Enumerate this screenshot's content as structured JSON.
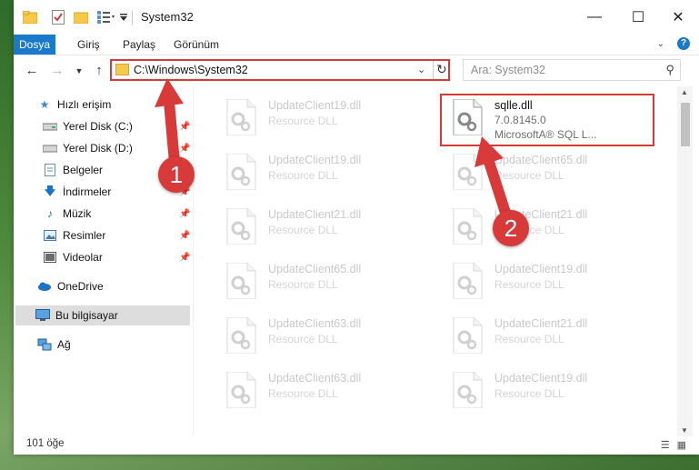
{
  "window": {
    "title": "System32"
  },
  "ribbon": {
    "tabs": [
      "Dosya",
      "Giriş",
      "Paylaş",
      "Görünüm"
    ]
  },
  "window_buttons": {
    "minimize": "—",
    "maximize": "☐",
    "close": "✕"
  },
  "navigation": {
    "address": "C:\\Windows\\System32",
    "search_placeholder": "Ara: System32"
  },
  "sidebar": {
    "items": [
      {
        "label": "Hızlı erişim",
        "icon": "star-icon",
        "pinned": false
      },
      {
        "label": "Yerel Disk (C:)",
        "icon": "drive-icon",
        "pinned": true
      },
      {
        "label": "Yerel Disk (D:)",
        "icon": "drive-icon",
        "pinned": true
      },
      {
        "label": "Belgeler",
        "icon": "documents-icon",
        "pinned": true
      },
      {
        "label": "İndirmeler",
        "icon": "downloads-icon",
        "pinned": true
      },
      {
        "label": "Müzik",
        "icon": "music-icon",
        "pinned": true
      },
      {
        "label": "Resimler",
        "icon": "pictures-icon",
        "pinned": true
      },
      {
        "label": "Videolar",
        "icon": "videos-icon",
        "pinned": true
      },
      {
        "label": "OneDrive",
        "icon": "cloud-icon",
        "pinned": false
      },
      {
        "label": "Bu bilgisayar",
        "icon": "computer-icon",
        "pinned": false
      },
      {
        "label": "Ağ",
        "icon": "network-icon",
        "pinned": false
      }
    ]
  },
  "files": {
    "active": {
      "name": "sqlle.dll",
      "version": "7.0.8145.0",
      "company": "MicrosoftA® SQL L..."
    },
    "left_column": [
      {
        "name": "UpdateClient19.dll",
        "desc": "Resource DLL"
      },
      {
        "name": "UpdateClient19.dll",
        "desc": "Resource DLL"
      },
      {
        "name": "UpdateClient21.dll",
        "desc": "Resource DLL"
      },
      {
        "name": "UpdateClient65.dll",
        "desc": "Resource DLL"
      },
      {
        "name": "UpdateClient63.dll",
        "desc": "Resource DLL"
      },
      {
        "name": "UpdateClient63.dll",
        "desc": "Resource DLL"
      }
    ],
    "right_column": [
      {
        "name": "UpdateClient65.dll",
        "desc": "Resource DLL"
      },
      {
        "name": "UpdateClient21.dll",
        "desc": "Resource DLL"
      },
      {
        "name": "UpdateClient19.dll",
        "desc": "Resource DLL"
      },
      {
        "name": "UpdateClient21.dll",
        "desc": "Resource DLL"
      },
      {
        "name": "UpdateClient19.dll",
        "desc": "Resource DLL"
      }
    ]
  },
  "status": {
    "item_count": "101 öğe"
  },
  "annotations": {
    "badge1": "1",
    "badge2": "2",
    "color": "#d83a3a"
  }
}
